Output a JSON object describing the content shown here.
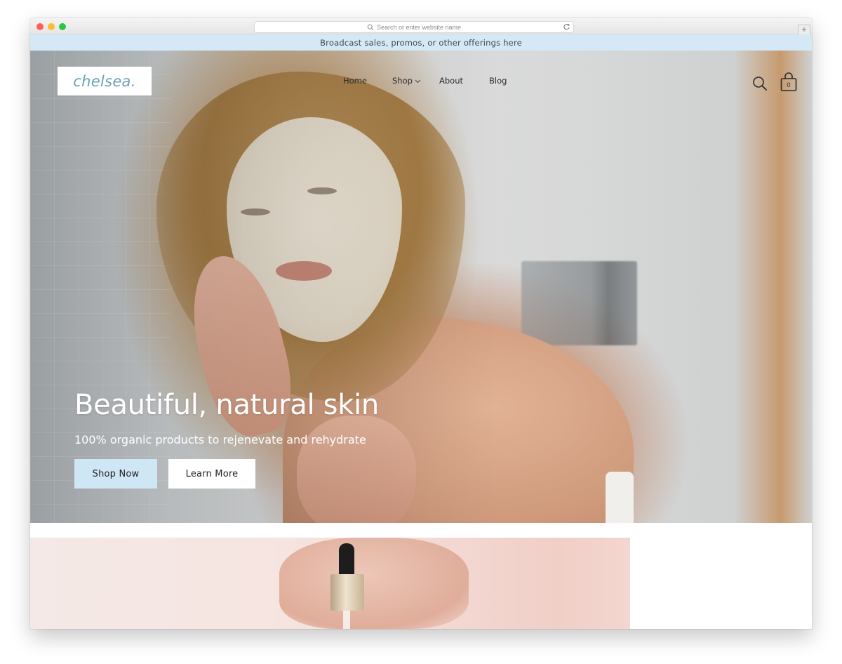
{
  "browser": {
    "address_placeholder": "Search or enter website name",
    "new_tab_symbol": "+"
  },
  "announcement": {
    "text": "Broadcast sales, promos, or other offerings here"
  },
  "header": {
    "logo_text": "chelsea.",
    "nav": {
      "home": "Home",
      "shop": "Shop",
      "about": "About",
      "blog": "Blog"
    },
    "cart_count": "0",
    "icons": [
      "search-icon",
      "shopping-bag-icon",
      "chevron-down-icon"
    ]
  },
  "hero": {
    "headline": "Beautiful, natural skin",
    "subheadline": "100% organic products to rejenevate and rehydrate",
    "primary_button": "Shop Now",
    "secondary_button": "Learn More"
  },
  "colors": {
    "accent_light_blue": "#d4e9f5",
    "button_blue": "#cfe6f4",
    "logo_teal": "#6aa3b3"
  }
}
